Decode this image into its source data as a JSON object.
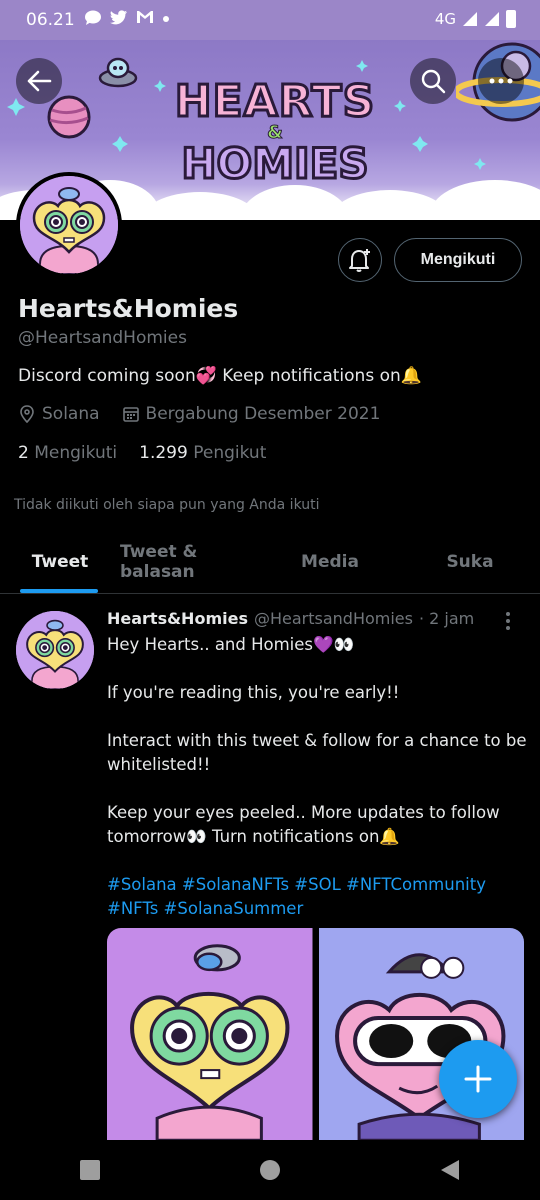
{
  "status_bar": {
    "time": "06.21",
    "network": "4G"
  },
  "banner": {
    "line1": "HEARTS",
    "amp": "&",
    "line2": "HOMIES"
  },
  "profile": {
    "display_name": "Hearts&Homies",
    "handle": "@HeartsandHomies",
    "bio": "Discord coming soon💞 Keep notifications on🔔",
    "location": "Solana",
    "joined": "Bergabung Desember 2021",
    "following_count": "2",
    "following_label": "Mengikuti",
    "followers_count": "1.299",
    "followers_label": "Pengikut",
    "follow_context": "Tidak diikuti oleh siapa pun yang Anda ikuti"
  },
  "actions": {
    "follow_button_label": "Mengikuti"
  },
  "tabs": [
    {
      "label": "Tweet",
      "active": true
    },
    {
      "label": "Tweet & balasan",
      "active": false
    },
    {
      "label": "Media",
      "active": false
    },
    {
      "label": "Suka",
      "active": false
    }
  ],
  "tweet": {
    "name": "Hearts&Homies",
    "handle": "@HeartsandHomies",
    "time": "· 2 jam",
    "line1": "Hey Hearts.. and Homies💜👀",
    "para2": "If you're reading this, you're early!!",
    "para3": "Interact with this tweet & follow for a chance to be whitelisted!!",
    "para4": "Keep your eyes peeled.. More updates to follow tomorrow👀 Turn notifications on🔔",
    "hashtags": "#Solana #SolanaNFTs #SOL #NFTCommunity #NFTs #SolanaSummer"
  },
  "colors": {
    "accent": "#1d9bf0",
    "secondary_text": "#71767b",
    "banner_purple": "#9b86c8"
  },
  "icons": {
    "back": "arrow-left-icon",
    "search": "search-icon",
    "more": "more-icon",
    "notify": "bell-plus-icon",
    "location": "location-pin-icon",
    "calendar": "calendar-icon",
    "compose": "plus-icon"
  }
}
